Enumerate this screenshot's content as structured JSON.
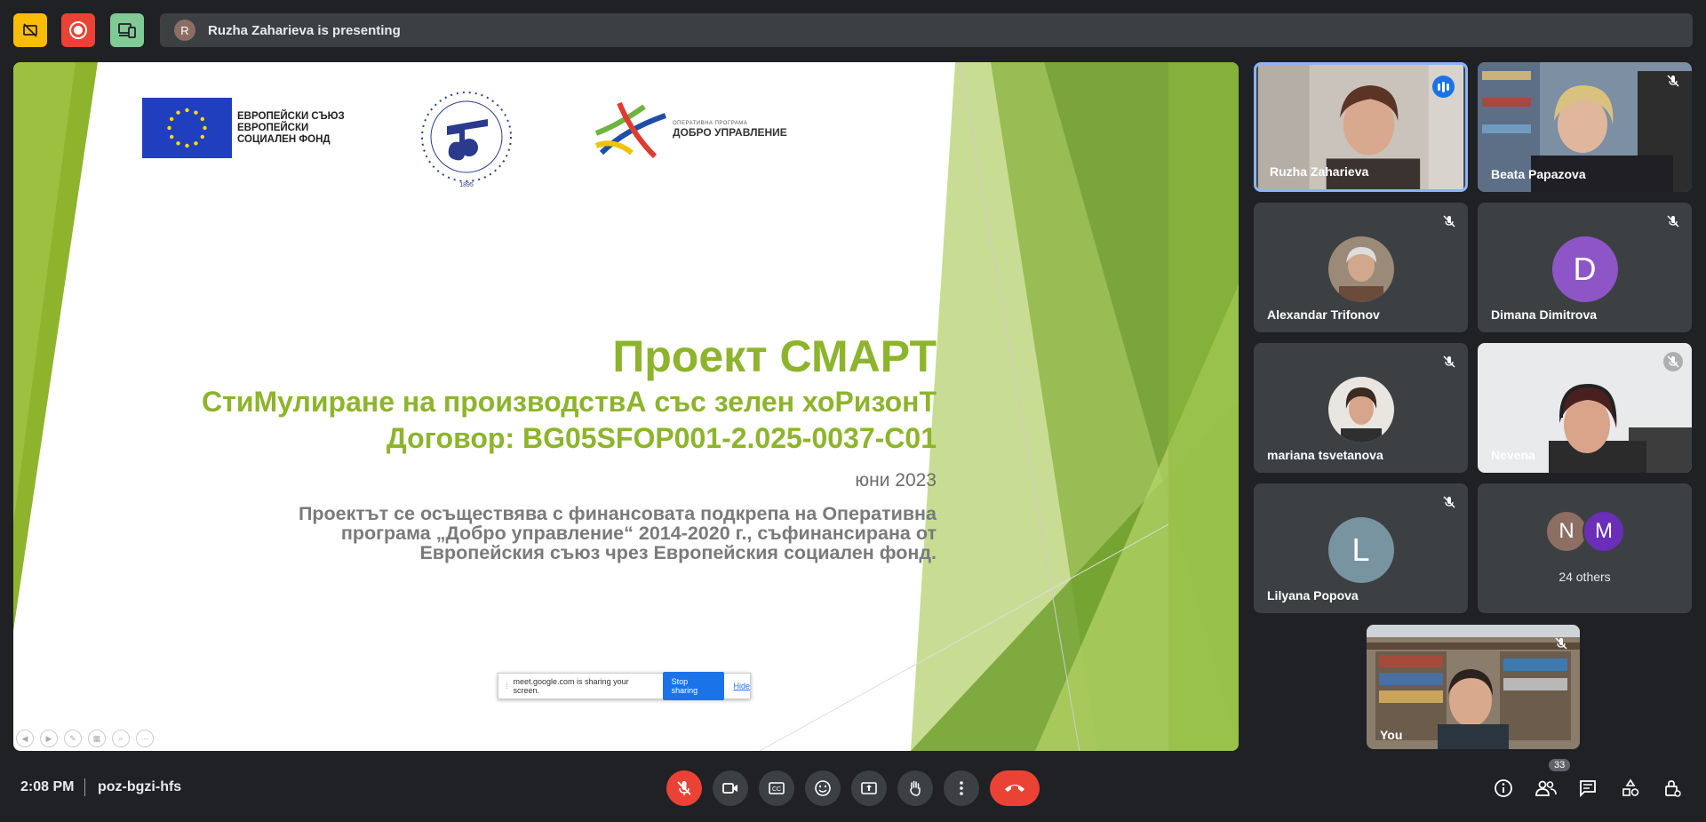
{
  "top": {
    "presenting_initial": "R",
    "presenting_text": "Ruzha Zaharieva is presenting"
  },
  "slide": {
    "eu_logo_text": "ЕВРОПЕЙСКИ СЪЮЗ\nЕВРОПЕЙСКИ\nСОЦИАЛЕН ФОНД",
    "seal_year": "1895",
    "op_small": "ОПЕРАТИВНА ПРОГРАМА",
    "op_big": "ДОБРО УПРАВЛЕНИЕ",
    "title": "Проект СМАРТ",
    "subtitle": "СтиМулиране на производствА със зелен хоРизонТ",
    "contract": "Договор: BG05SFOP001-2.025-0037-C01",
    "date": "юни 2023",
    "body": "Проектът се осъществява с финансовата подкрепа на Оперативна програма „Добро управление“ 2014-2020 г., съфинансирана от Европейския съюз чрез Европейския социален фонд.",
    "share_notice_text": "meet.google.com is sharing your screen.",
    "stop_sharing": "Stop sharing",
    "hide": "Hide"
  },
  "participants": [
    {
      "name": "Ruzha Zaharieva"
    },
    {
      "name": "Beata Papazova"
    },
    {
      "name": "Alexandar Trifonov"
    },
    {
      "name": "Dimana Dimitrova",
      "initial": "D"
    },
    {
      "name": "mariana tsvetanova"
    },
    {
      "name": "Nevena"
    },
    {
      "name": "Lilyana Popova",
      "initial": "L"
    },
    {
      "others_label": "24 others",
      "initials": [
        "N",
        "M"
      ]
    },
    {
      "name": "You"
    }
  ],
  "bottom": {
    "time": "2:08 PM",
    "meeting_code": "poz-bgzi-hfs",
    "people_count": "33"
  },
  "colors": {
    "accent_green": "#8db42c",
    "hangup_red": "#ea4335",
    "active_border": "#8ab4f8"
  },
  "icons": [
    "no-captions-icon",
    "record-icon",
    "companion-icon",
    "mic-off-icon",
    "camera-icon",
    "captions-icon",
    "emoji-icon",
    "present-icon",
    "raise-hand-icon",
    "more-icon",
    "hangup-icon",
    "info-icon",
    "people-icon",
    "chat-icon",
    "activities-icon",
    "host-controls-icon"
  ]
}
